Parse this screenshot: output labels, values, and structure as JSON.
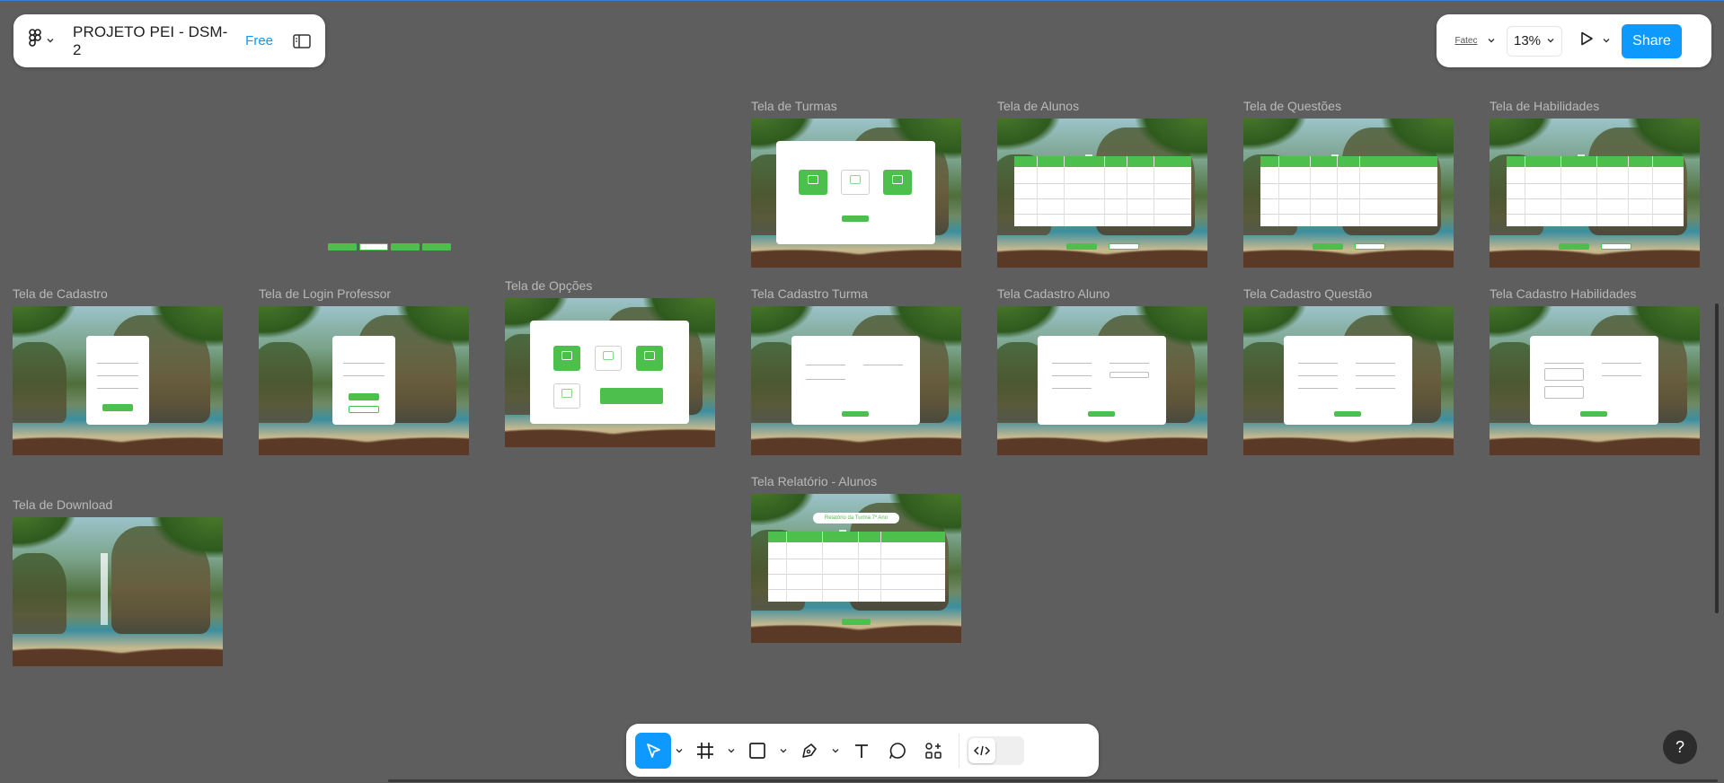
{
  "header": {
    "file_title": "PROJETO PEI - DSM-2",
    "plan_badge": "Free",
    "logo_icon": "figma-logo-icon",
    "sidebar_icon": "panel-toggle-icon"
  },
  "right_controls": {
    "avatar_text": "Fatec",
    "zoom_level": "13%",
    "share_label": "Share",
    "play_icon": "play-icon"
  },
  "toolbar": {
    "tools": [
      "move-tool",
      "frame-tool",
      "rectangle-tool",
      "pen-tool",
      "text-tool",
      "comment-tool",
      "assets-tool"
    ],
    "dev_mode_icon": "code-icon"
  },
  "help": {
    "label": "?"
  },
  "frames": {
    "turmas": "Tela de Turmas",
    "alunos": "Tela de Alunos",
    "questoes": "Tela de Questões",
    "habilidades": "Tela de Habilidades",
    "cadastro": "Tela de Cadastro",
    "login": "Tela de Login Professor",
    "opcoes": "Tela de Opções",
    "cadastro_turma": "Tela Cadastro Turma",
    "cadastro_aluno": "Tela Cadastro Aluno",
    "cadastro_questao": "Tela Cadastro Questão",
    "cadastro_habilidades": "Tela Cadastro Habilidades",
    "download": "Tela de Download",
    "relatorio": "Tela Relatório - Alunos"
  },
  "frame_content": {
    "relatorio_title": "Relatório da Turma 7º Ano"
  },
  "colors": {
    "canvas": "#5e5e5e",
    "accent": "#0d99ff",
    "frame_green": "#4cbf4c"
  }
}
